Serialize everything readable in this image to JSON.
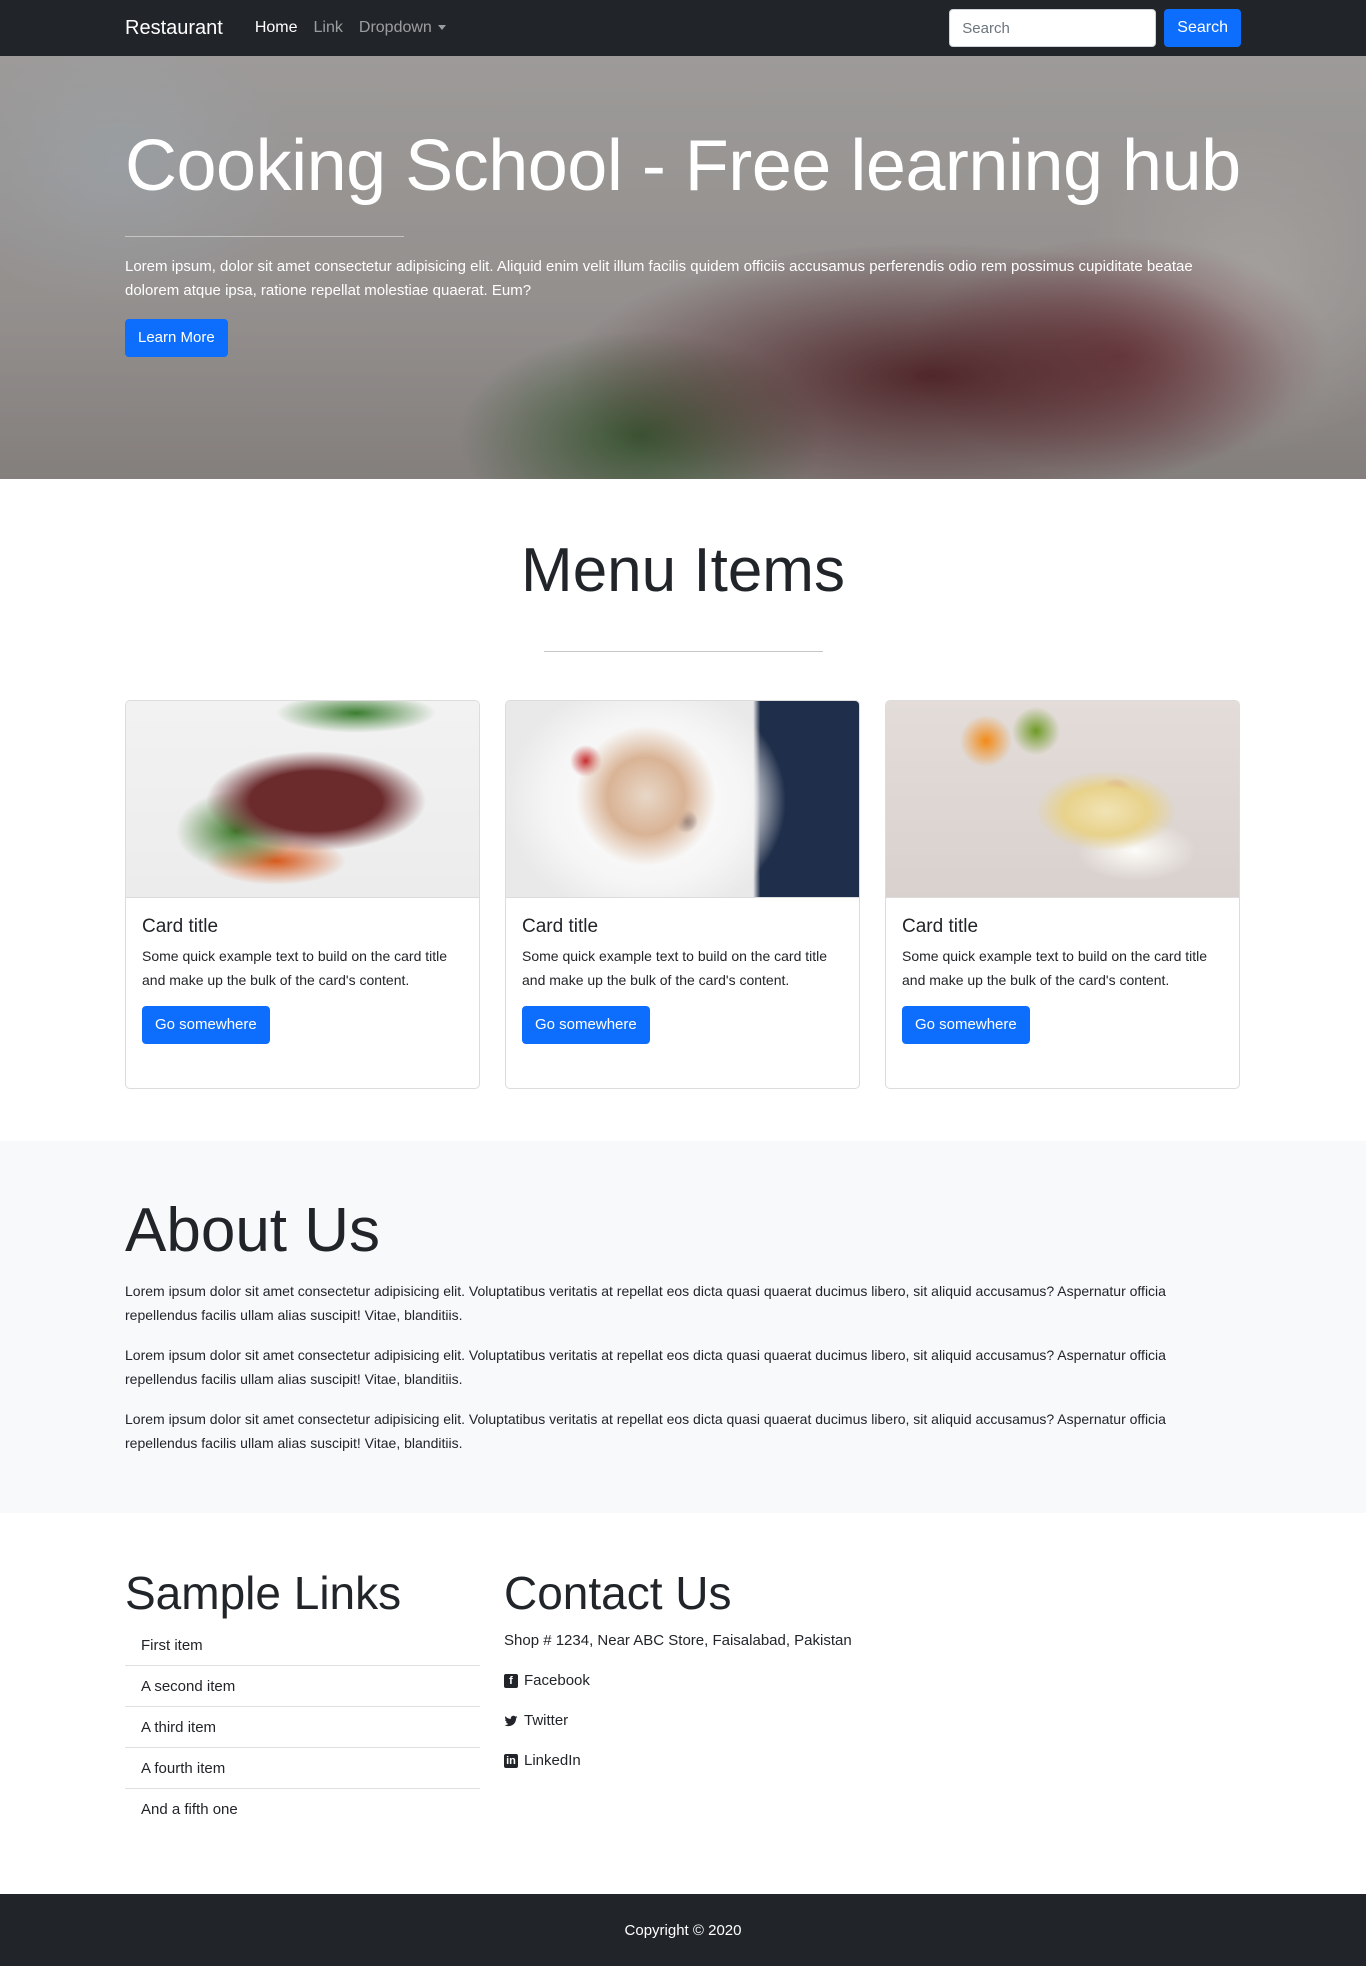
{
  "navbar": {
    "brand": "Restaurant",
    "links": [
      "Home",
      "Link",
      "Dropdown"
    ],
    "search_placeholder": "Search",
    "search_button": "Search"
  },
  "hero": {
    "title": "Cooking School - Free learning hub",
    "text": "Lorem ipsum, dolor sit amet consectetur adipisicing elit. Aliquid enim velit illum facilis quidem officiis accusamus perferendis odio rem possimus cupiditate beatae dolorem atque ipsa, ratione repellat molestiae quaerat. Eum?",
    "button": "Learn More"
  },
  "menu": {
    "heading": "Menu Items",
    "cards": [
      {
        "title": "Card title",
        "text": "Some quick example text to build on the card title and make up the bulk of the card's content.",
        "button": "Go somewhere"
      },
      {
        "title": "Card title",
        "text": "Some quick example text to build on the card title and make up the bulk of the card's content.",
        "button": "Go somewhere"
      },
      {
        "title": "Card title",
        "text": "Some quick example text to build on the card title and make up the bulk of the card's content.",
        "button": "Go somewhere"
      }
    ]
  },
  "about": {
    "heading": "About Us",
    "paragraphs": [
      "Lorem ipsum dolor sit amet consectetur adipisicing elit. Voluptatibus veritatis at repellat eos dicta quasi quaerat ducimus libero, sit aliquid accusamus? Aspernatur officia repellendus facilis ullam alias suscipit! Vitae, blanditiis.",
      "Lorem ipsum dolor sit amet consectetur adipisicing elit. Voluptatibus veritatis at repellat eos dicta quasi quaerat ducimus libero, sit aliquid accusamus? Aspernatur officia repellendus facilis ullam alias suscipit! Vitae, blanditiis.",
      "Lorem ipsum dolor sit amet consectetur adipisicing elit. Voluptatibus veritatis at repellat eos dicta quasi quaerat ducimus libero, sit aliquid accusamus? Aspernatur officia repellendus facilis ullam alias suscipit! Vitae, blanditiis."
    ]
  },
  "sample_links": {
    "heading": "Sample Links",
    "items": [
      "First item",
      "A second item",
      "A third item",
      "A fourth item",
      "And a fifth one"
    ]
  },
  "contact": {
    "heading": "Contact Us",
    "address": "Shop # 1234, Near ABC Store, Faisalabad, Pakistan",
    "social": [
      {
        "icon": "facebook-icon",
        "label": "Facebook"
      },
      {
        "icon": "twitter-icon",
        "label": "Twitter"
      },
      {
        "icon": "linkedin-icon",
        "label": "LinkedIn"
      }
    ]
  },
  "footer": {
    "copyright": "Copyright © 2020"
  },
  "colors": {
    "navbar_bg": "#212529",
    "primary": "#0d6efd",
    "light_bg": "#f8f9fa"
  }
}
